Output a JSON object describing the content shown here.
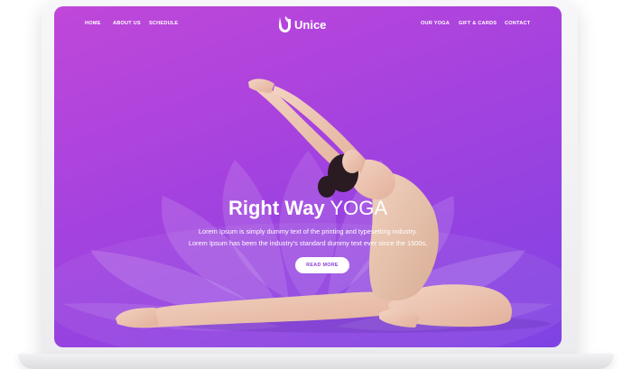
{
  "nav": {
    "left": [
      "HOME",
      "ABOUT US",
      "SCHEDULE"
    ],
    "right": [
      "OUR YOGA",
      "GIFT & CARDS",
      "CONTACT"
    ]
  },
  "logo": {
    "text": "Unice",
    "icon": "u-leaf-logo-icon"
  },
  "hero": {
    "title_bold": "Right Way",
    "title_light": "YOGA",
    "line1": "Lorem Ipsum is simply dummy text of the printing and typesetting industry.",
    "line2": "Lorem Ipsum has been the industry's standard dummy text ever since the 1500s,",
    "button": "READ MORE"
  },
  "colors": {
    "gradient_start": "#c047d9",
    "gradient_end": "#7f43e3",
    "button_text": "#8e3fd6"
  }
}
